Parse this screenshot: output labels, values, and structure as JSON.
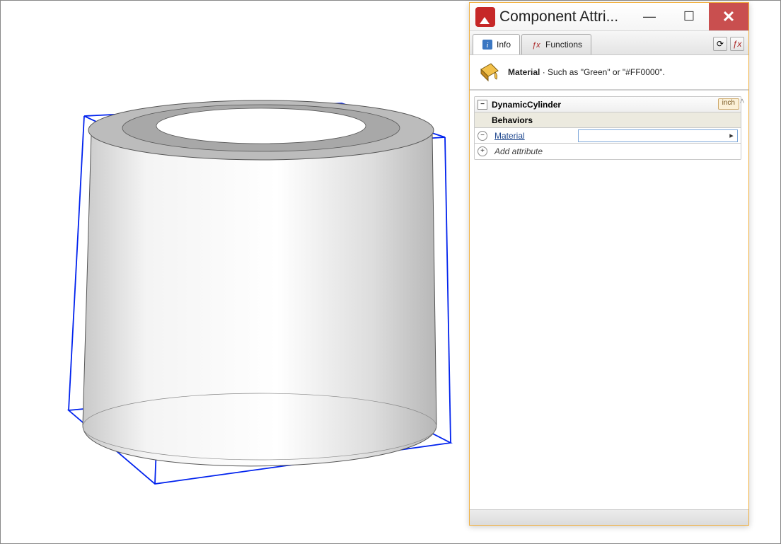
{
  "window": {
    "title": "Component Attri..."
  },
  "tabs": {
    "info": "Info",
    "functions": "Functions"
  },
  "description": {
    "label": "Material",
    "text": " · Such as \"Green\" or \"#FF0000\"."
  },
  "tree": {
    "component_name": "DynamicCylinder",
    "unit_badge": "inch",
    "section_label": "Behaviors",
    "attribute": {
      "name": "Material",
      "value": ""
    },
    "add_label": "Add attribute"
  },
  "icons": {
    "minus": "−",
    "plus": "+",
    "box_minus": "⊟",
    "circle_plus": "⊕",
    "circle_minus": "⊖",
    "chev_up": "˄",
    "chev_down": "˅",
    "refresh": "⟳",
    "fx": "ƒx",
    "close": "✕",
    "minimize": "—",
    "maximize": "☐",
    "info": "i",
    "field_arrow": "▸"
  }
}
